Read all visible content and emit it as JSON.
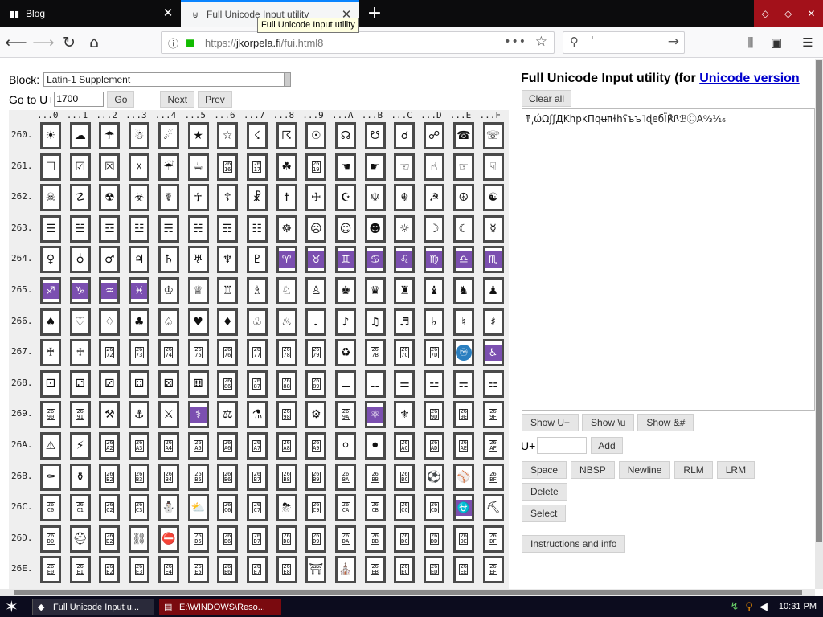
{
  "browser": {
    "tabs": [
      {
        "title": "Blog",
        "favicon": "blog-icon",
        "active": false
      },
      {
        "title": "Full Unicode Input utility",
        "favicon": "page-icon",
        "active": true
      }
    ],
    "tooltip": "Full Unicode Input utility",
    "url_prefix": "https://",
    "url_domain": "jkorpela.fi",
    "url_path": "/fui.html8",
    "search_text": "'"
  },
  "controls": {
    "block_label": "Block:",
    "block_value": "Latin-1 Supplement",
    "goto_label": "Go to U+",
    "goto_value": "1700",
    "go_label": "Go",
    "next_label": "Next",
    "prev_label": "Prev"
  },
  "grid": {
    "columns": [
      "0",
      "1",
      "2",
      "3",
      "4",
      "5",
      "6",
      "7",
      "8",
      "9",
      "A",
      "B",
      "C",
      "D",
      "E",
      "F"
    ],
    "rows": [
      {
        "label": "260.",
        "cells": [
          "☀",
          "☁",
          "☂",
          "☃",
          "☄",
          "★",
          "☆",
          "☇",
          "☈",
          "☉",
          "☊",
          "☋",
          "☌",
          "☍",
          "☎",
          "☏"
        ]
      },
      {
        "label": "261.",
        "cells": [
          "☐",
          "☑",
          "☒",
          "☓",
          "☔",
          "☕",
          "#2616",
          "#2617",
          "☘",
          "#2619",
          "☚",
          "☛",
          "☜",
          "☝",
          "☞",
          "☟"
        ]
      },
      {
        "label": "262.",
        "cells": [
          "☠",
          "☡",
          "☢",
          "☣",
          "☤",
          "☥",
          "☦",
          "☧",
          "☨",
          "☩",
          "☪",
          "☫",
          "☬",
          "☭",
          "☮",
          "☯"
        ]
      },
      {
        "label": "263.",
        "cells": [
          "☰",
          "☱",
          "☲",
          "☳",
          "☴",
          "☵",
          "☶",
          "☷",
          "☸",
          "☹",
          "☺",
          "☻",
          "☼",
          "☽",
          "☾",
          "☿"
        ]
      },
      {
        "label": "264.",
        "cells": [
          "♀",
          "♁",
          "♂",
          "♃",
          "♄",
          "♅",
          "♆",
          "♇",
          "♈",
          "♉",
          "♊",
          "♋",
          "♌",
          "♍",
          "♎",
          "♏"
        ]
      },
      {
        "label": "265.",
        "cells": [
          "♐",
          "♑",
          "♒",
          "♓",
          "♔",
          "♕",
          "♖",
          "♗",
          "♘",
          "♙",
          "♚",
          "♛",
          "♜",
          "♝",
          "♞",
          "♟"
        ]
      },
      {
        "label": "266.",
        "cells": [
          "♠",
          "♡",
          "♢",
          "♣",
          "♤",
          "♥",
          "♦",
          "♧",
          "♨",
          "♩",
          "♪",
          "♫",
          "♬",
          "♭",
          "♮",
          "♯"
        ]
      },
      {
        "label": "267.",
        "cells": [
          "♰",
          "♱",
          "#2672",
          "#2673",
          "#2674",
          "#2675",
          "#2676",
          "#2677",
          "#2678",
          "#2679",
          "♻",
          "#267B",
          "#267C",
          "#267D",
          "♾",
          "♿"
        ]
      },
      {
        "label": "268.",
        "cells": [
          "⚀",
          "⚁",
          "⚂",
          "⚃",
          "⚄",
          "⚅",
          "#2686",
          "#2687",
          "#2688",
          "#2689",
          "⚊",
          "⚋",
          "⚌",
          "⚍",
          "⚎",
          "⚏"
        ]
      },
      {
        "label": "269.",
        "cells": [
          "#2690",
          "#2691",
          "⚒",
          "⚓",
          "⚔",
          "⚕",
          "⚖",
          "⚗",
          "#2698",
          "⚙",
          "#269A",
          "⚛",
          "⚜",
          "#269D",
          "#269E",
          "#269F"
        ]
      },
      {
        "label": "26A.",
        "cells": [
          "⚠",
          "⚡",
          "#26A2",
          "#26A3",
          "#26A4",
          "#26A5",
          "#26A6",
          "#26A7",
          "#26A8",
          "#26A9",
          "⚪",
          "⚫",
          "#26AC",
          "#26AD",
          "#26AE",
          "#26AF"
        ]
      },
      {
        "label": "26B.",
        "cells": [
          "⚰",
          "⚱",
          "#26B2",
          "#26B3",
          "#26B4",
          "#26B5",
          "#26B6",
          "#26B7",
          "#26B8",
          "#26B9",
          "#26BA",
          "#26BB",
          "#26BC",
          "⚽",
          "⚾",
          "#26BF"
        ]
      },
      {
        "label": "26C.",
        "cells": [
          "#26C0",
          "#26C1",
          "#26C2",
          "#26C3",
          "⛄",
          "⛅",
          "#26C6",
          "#26C7",
          "⛈",
          "#26C9",
          "#26CA",
          "#26CB",
          "#26CC",
          "#26CD",
          "⛎",
          "⛏"
        ]
      },
      {
        "label": "26D.",
        "cells": [
          "#26D0",
          "⛑",
          "#26D2",
          "⛓",
          "⛔",
          "#26D5",
          "#26D6",
          "#26D7",
          "#26D8",
          "#26D9",
          "#26DA",
          "#26DB",
          "#26DC",
          "#26DD",
          "#26DE",
          "#26DF"
        ]
      },
      {
        "label": "26E.",
        "cells": [
          "#26E0",
          "#26E1",
          "#26E2",
          "#26E3",
          "#26E4",
          "#26E5",
          "#26E6",
          "#26E7",
          "#26E8",
          "⛩",
          "⛪",
          "#26EB",
          "#26EC",
          "#26ED",
          "#26EE",
          "#26EF"
        ]
      }
    ],
    "purple_cells": [
      "264.8",
      "264.9",
      "264.A",
      "264.B",
      "264.C",
      "264.D",
      "264.E",
      "264.F",
      "265.0",
      "265.1",
      "265.2",
      "265.3",
      "269.5",
      "269.B",
      "26C.E",
      "267.F"
    ],
    "blue_cells": [
      "267.E"
    ]
  },
  "right": {
    "title_prefix": "Full Unicode Input utility (for ",
    "title_link": "Unicode version",
    "clear_label": "Clear all",
    "output_text": "ͳ͵ώΩʃʃДKhpκΠqʉπɫhʕъъ˥ɖeбÏ℟ꟗℬⒸA⁰⁄₃⅟₁₆",
    "show_u_label": "Show U+",
    "show_esc_label": "Show \\u",
    "show_ent_label": "Show &#",
    "add_prefix": "U+",
    "add_label": "Add",
    "space_label": "Space",
    "nbsp_label": "NBSP",
    "newline_label": "Newline",
    "rlm_label": "RLM",
    "lrm_label": "LRM",
    "delete_label": "Delete",
    "select_label": "Select",
    "instructions_label": "Instructions and info"
  },
  "taskbar": {
    "task1": "Full Unicode Input u...",
    "task2": "E:\\WINDOWS\\Reso...",
    "clock": "10:31 PM"
  },
  "colors": {
    "accent": "#0a84ff",
    "purple": "#7b4fb0",
    "link": "#0000cc",
    "taskbar": "#0c0c1e"
  }
}
